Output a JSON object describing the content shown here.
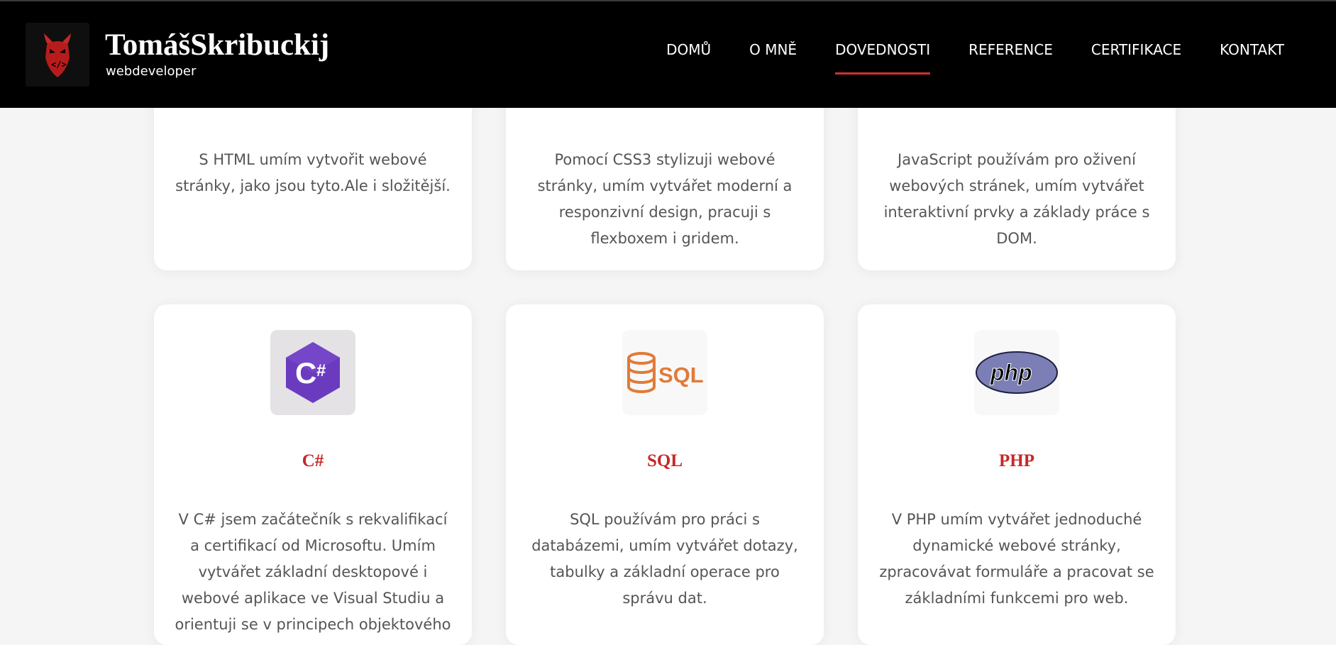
{
  "header": {
    "brand_name": "TomášSkribuckij",
    "brand_subtitle": "webdeveloper",
    "logo_icon": "devil-mask-code-icon",
    "nav": [
      "DOMŮ",
      "O MNĚ",
      "DOVEDNOSTI",
      "REFERENCE",
      "CERTIFIKACE",
      "KONTAKT"
    ],
    "active_nav": "DOVEDNOSTI"
  },
  "colors": {
    "accent": "#c62828",
    "header_bg": "#000000",
    "page_bg": "#f5f5f5"
  },
  "skills_top": [
    {
      "description": "S HTML umím vytvořit webové stránky, jako jsou tyto.Ale i složitější."
    },
    {
      "description": "Pomocí CSS3 stylizuji webové stránky, umím vytvářet moderní a responzivní design, pracuji s flexboxem i gridem."
    },
    {
      "description": "JavaScript používám pro oživení webových stránek, umím vytvářet interaktivní prvky a základy práce s DOM."
    }
  ],
  "skills_bottom": [
    {
      "title": "C#",
      "icon": "csharp-logo-icon",
      "description": "V C# jsem začátečník s rekvalifikací a certifikací od Microsoftu. Umím vytvářet základní desktopové i webové aplikace ve Visual Studiu a orientuji se v principech objektového"
    },
    {
      "title": "SQL",
      "icon": "sql-database-icon",
      "description": "SQL používám pro práci s databázemi, umím vytvářet dotazy, tabulky a základní operace pro správu dat."
    },
    {
      "title": "PHP",
      "icon": "php-logo-icon",
      "description": "V PHP umím vytvářet jednoduché dynamické webové stránky, zpracovávat formuláře a pracovat se základními funkcemi pro web."
    }
  ]
}
